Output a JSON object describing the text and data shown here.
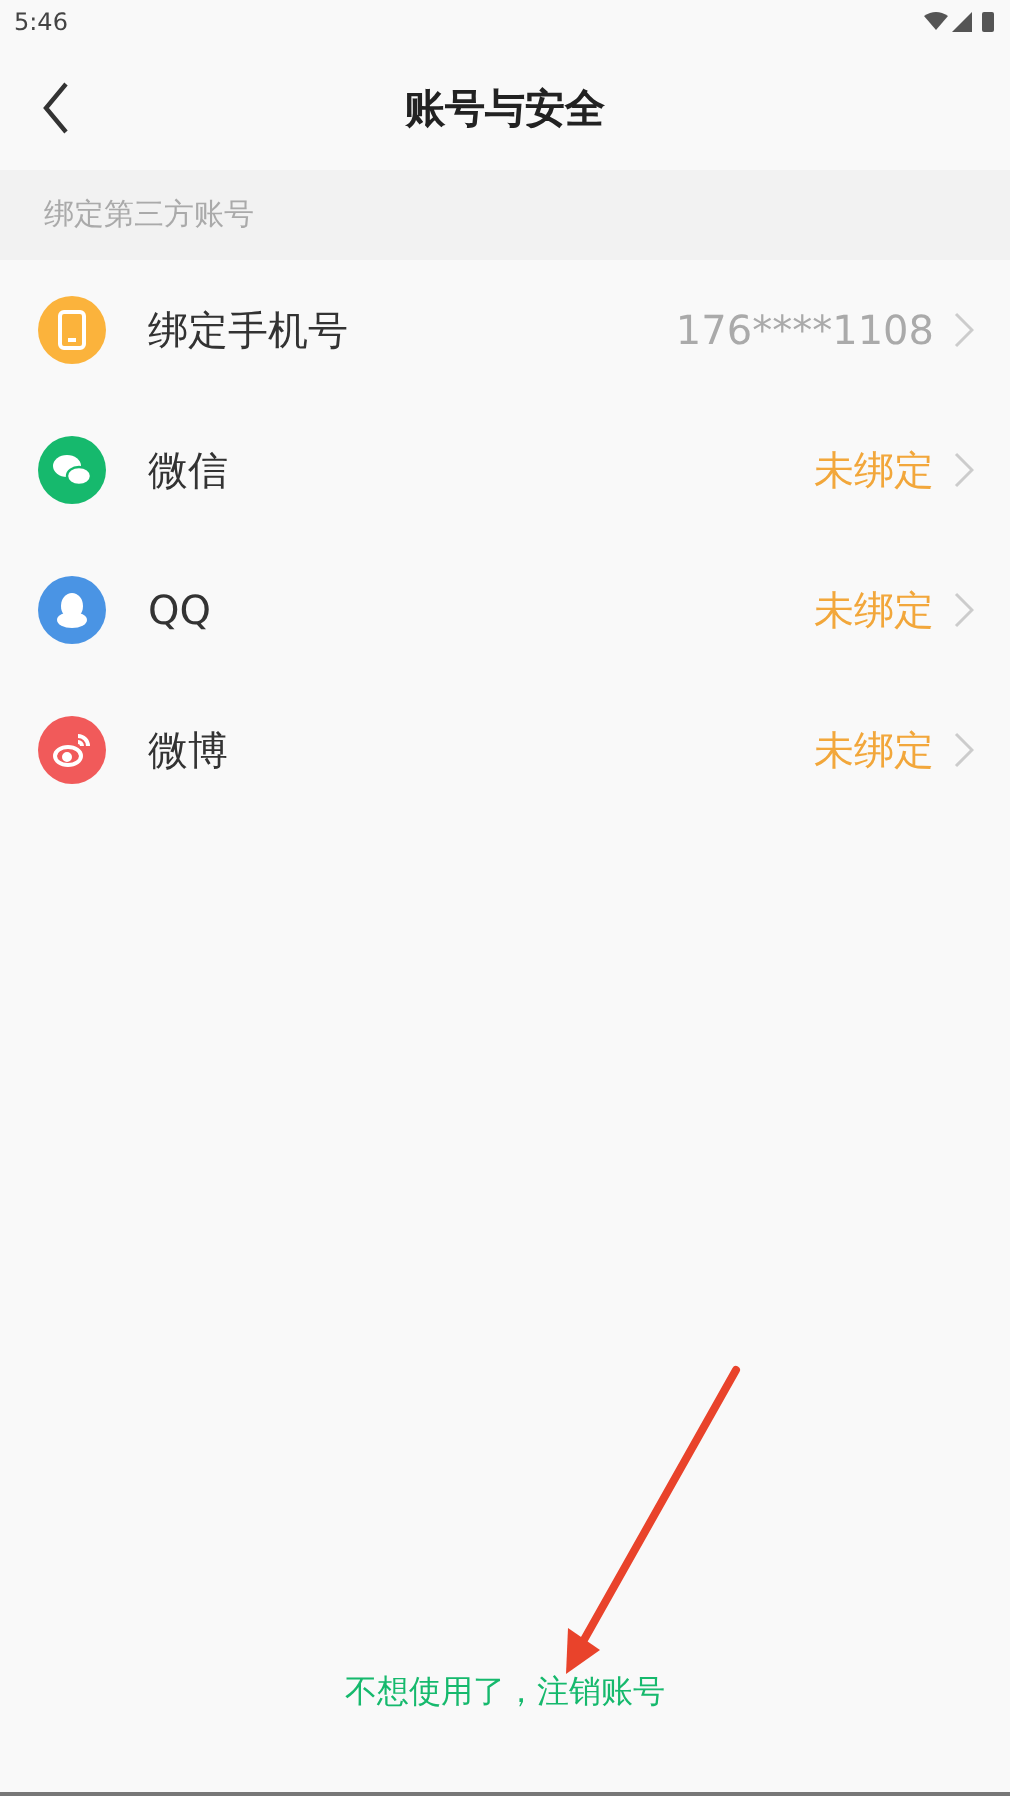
{
  "status_bar": {
    "time": "5:46"
  },
  "header": {
    "title": "账号与安全"
  },
  "section": {
    "title": "绑定第三方账号"
  },
  "accounts": [
    {
      "kind": "phone",
      "color": "#fbb33c",
      "label": "绑定手机号",
      "value": "176****1108",
      "bound": true
    },
    {
      "kind": "wechat",
      "color": "#16b96d",
      "label": "微信",
      "value": "未绑定",
      "bound": false
    },
    {
      "kind": "qq",
      "color": "#4a94e4",
      "label": "QQ",
      "value": "未绑定",
      "bound": false
    },
    {
      "kind": "weibo",
      "color": "#f15a5a",
      "label": "微博",
      "value": "未绑定",
      "bound": false
    }
  ],
  "footer": {
    "link": "不想使用了，注销账号"
  }
}
